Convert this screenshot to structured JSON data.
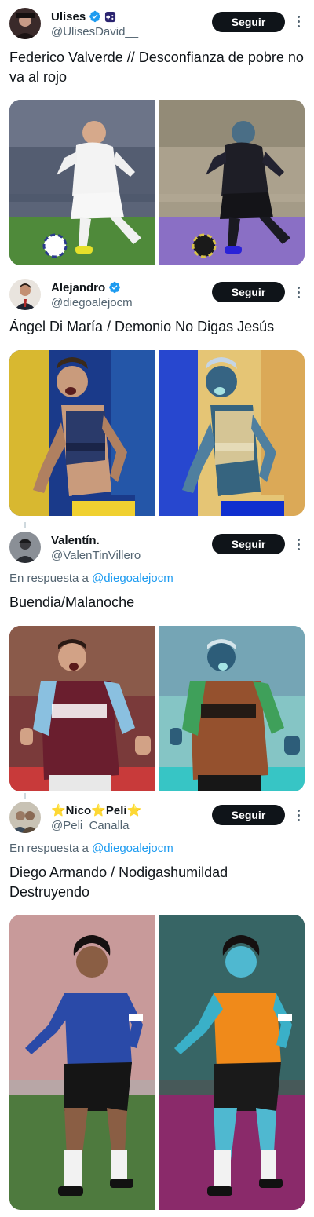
{
  "follow_label": "Seguir",
  "reply_prefix": "En respuesta a",
  "tweets": [
    {
      "display_name": "Ulises",
      "handle": "@UlisesDavid__",
      "verified": true,
      "text": "Federico Valverde // Desconfianza de pobre no va al rojo",
      "photos": [
        "football-player-original-photo",
        "football-player-inverted-photo"
      ]
    },
    {
      "display_name": "Alejandro",
      "handle": "@diegoalejocm",
      "verified": true,
      "text": "Ángel Di María / Demonio No Digas Jesús",
      "photos": [
        "football-player-original-photo",
        "football-player-inverted-photo"
      ]
    },
    {
      "display_name": "Valentín.",
      "handle": "@ValenTinVillero",
      "verified": false,
      "reply_to": "@diegoalejocm",
      "text": "Buendia/Malanoche",
      "photos": [
        "football-player-original-photo",
        "football-player-inverted-photo"
      ]
    },
    {
      "display_name": "⭐Nico⭐Peli⭐",
      "handle": "@Peli_Canalla",
      "verified": false,
      "reply_to": "@diegoalejocm",
      "text": "Diego Armando / Nodigashumildad Destruyendo",
      "photos": [
        "football-player-original-photo",
        "football-player-inverted-photo"
      ]
    }
  ],
  "colors": {
    "verified_blue": "#1d9bf0",
    "follow_button": "#0f1419",
    "secondary_text": "#536471",
    "link": "#1d9bf0"
  },
  "icons": [
    "verified-badge-icon",
    "more-options-icon"
  ]
}
